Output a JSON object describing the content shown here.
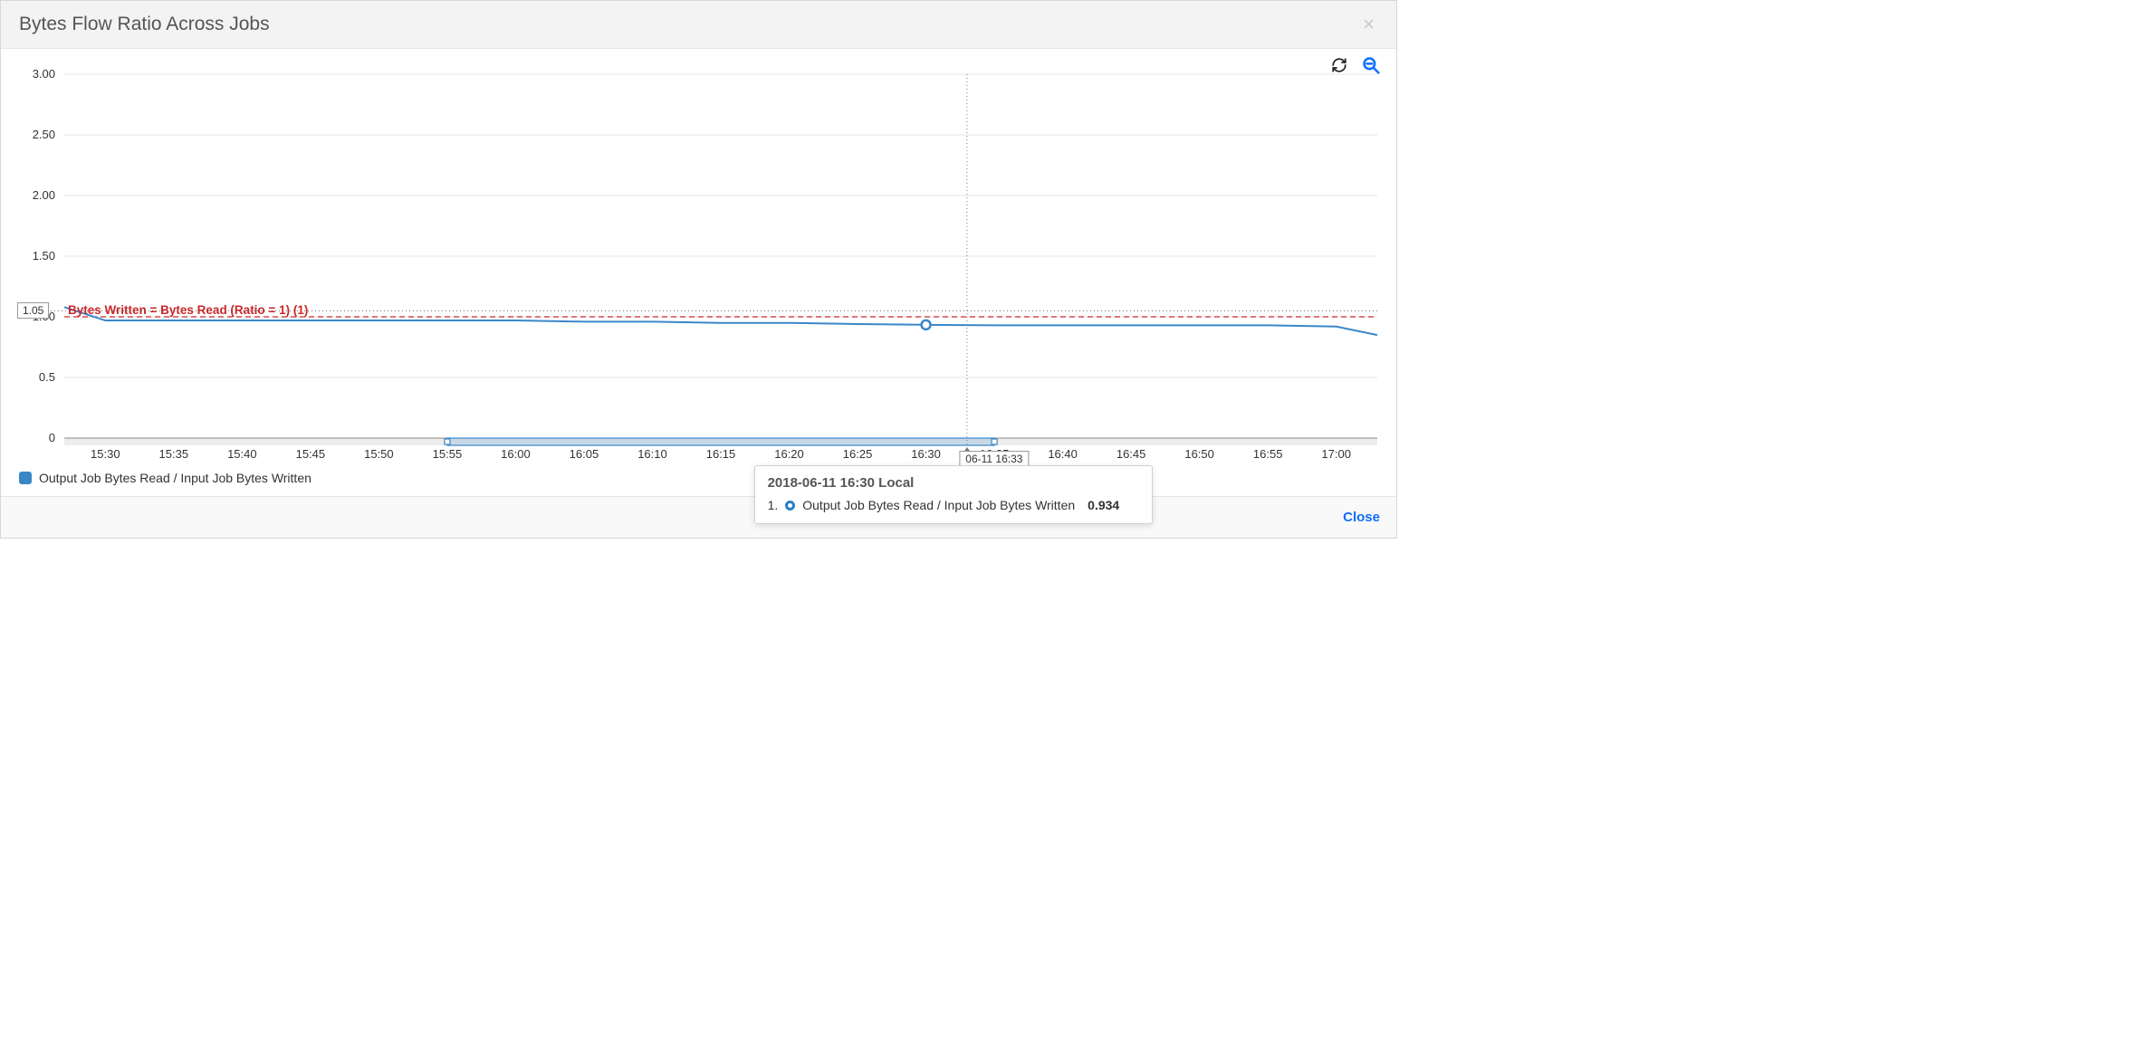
{
  "header": {
    "title": "Bytes Flow Ratio Across Jobs"
  },
  "toolbar": {
    "refresh_icon": "refresh-icon",
    "zoom_icon": "zoom-out-icon"
  },
  "legend": {
    "series_label": "Output Job Bytes Read / Input Job Bytes Written",
    "series_color": "#3a87c8"
  },
  "reference_line": {
    "label": "Bytes Written = Bytes Read (Ratio = 1) (1)",
    "value": 1
  },
  "y_marker": {
    "label": "1.05",
    "value": 1.05
  },
  "x_marker": {
    "label": "06-11 16:33",
    "time": "16:33"
  },
  "tooltip": {
    "title": "2018-06-11 16:30 Local",
    "row_index": "1.",
    "row_label": "Output Job Bytes Read / Input Job Bytes Written",
    "row_value": "0.934",
    "hover_time": "16:30"
  },
  "footer": {
    "close_label": "Close"
  },
  "chart_data": {
    "type": "line",
    "title": "Bytes Flow Ratio Across Jobs",
    "xlabel": "",
    "ylabel": "",
    "ylim": [
      0,
      3.0
    ],
    "xlim": [
      "15:27",
      "17:03"
    ],
    "y_ticks": [
      0,
      0.5,
      1.0,
      1.5,
      2.0,
      2.5,
      3.0
    ],
    "y_tick_labels": [
      "0",
      "0.5",
      "1.00",
      "1.50",
      "2.00",
      "2.50",
      "3.00"
    ],
    "x_ticks": [
      "15:30",
      "15:35",
      "15:40",
      "15:45",
      "15:50",
      "15:55",
      "16:00",
      "16:05",
      "16:10",
      "16:15",
      "16:20",
      "16:25",
      "16:30",
      "16:35",
      "16:40",
      "16:45",
      "16:50",
      "16:55",
      "17:00"
    ],
    "reference_lines": [
      {
        "label": "Bytes Written = Bytes Read (Ratio = 1) (1)",
        "y": 1,
        "color": "#c8282a",
        "style": "dashed"
      }
    ],
    "brush_range": [
      "15:55",
      "16:35"
    ],
    "cursor_x": "16:33",
    "hover_point": {
      "x": "16:30",
      "y": 0.934
    },
    "series": [
      {
        "name": "Output Job Bytes Read / Input Job Bytes Written",
        "color": "#3a87c8",
        "x": [
          "15:27",
          "15:30",
          "15:35",
          "15:40",
          "15:45",
          "15:50",
          "15:55",
          "16:00",
          "16:05",
          "16:10",
          "16:15",
          "16:20",
          "16:25",
          "16:30",
          "16:35",
          "16:40",
          "16:45",
          "16:50",
          "16:55",
          "17:00",
          "17:03"
        ],
        "y": [
          1.08,
          0.97,
          0.97,
          0.97,
          0.97,
          0.97,
          0.97,
          0.97,
          0.96,
          0.96,
          0.95,
          0.95,
          0.94,
          0.934,
          0.93,
          0.93,
          0.93,
          0.93,
          0.93,
          0.92,
          0.85
        ]
      }
    ]
  }
}
